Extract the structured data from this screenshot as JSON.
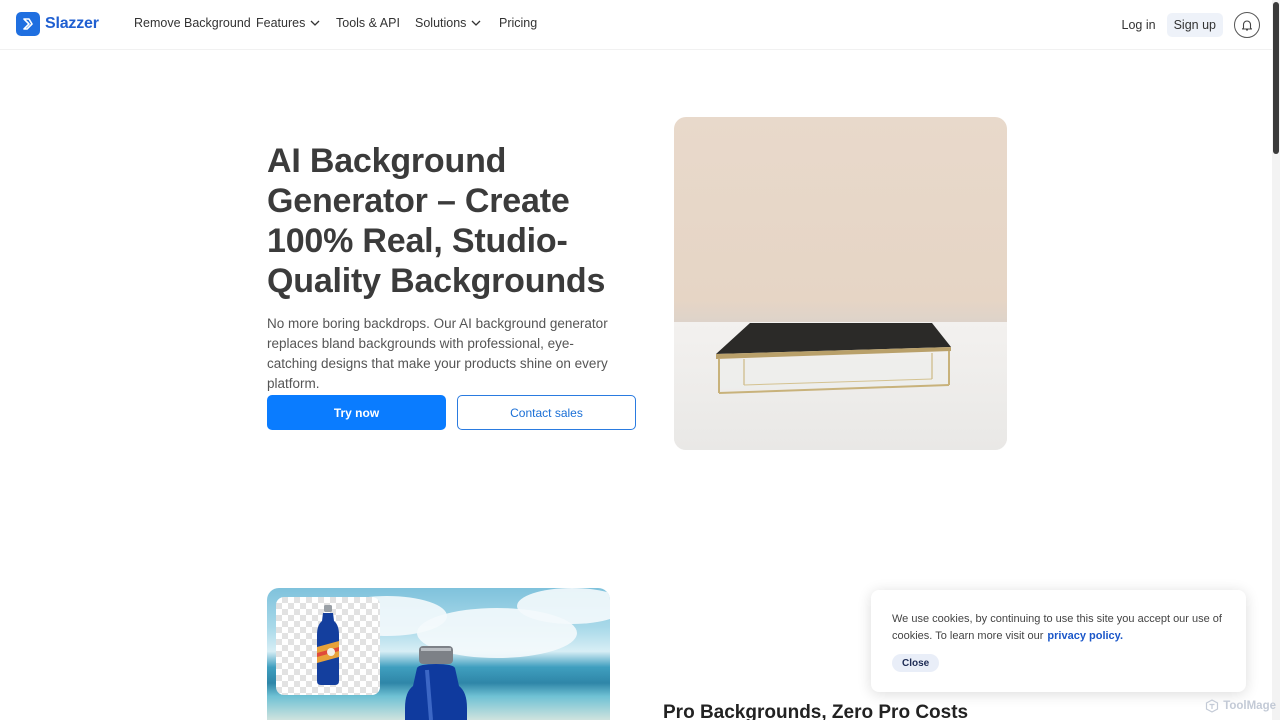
{
  "nav": {
    "logo_text": "Slazzer",
    "links": [
      {
        "label": "Remove Background"
      },
      {
        "label": "Features"
      },
      {
        "label": "Tools & API"
      },
      {
        "label": "Solutions"
      },
      {
        "label": "Pricing"
      }
    ],
    "login": "Log in",
    "signup": "Sign up"
  },
  "hero": {
    "title": "AI Background Generator – Create 100% Real, Studio-Quality Backgrounds",
    "description": "No more boring backdrops. Our AI background generator replaces bland backgrounds with professional, eye-catching designs that make your products shine on every platform.",
    "primary_button": "Try now",
    "secondary_button": "Contact sales"
  },
  "section2": {
    "title": "Pro Backgrounds, Zero Pro Costs"
  },
  "cookie": {
    "text": "We use cookies, by continuing to use this site you accept our use of cookies.  To learn more visit our",
    "link": "privacy policy.",
    "close": "Close"
  },
  "watermark": "ToolMage",
  "colors": {
    "brand": "#1f5fd1",
    "primary_button": "#0a7cff"
  }
}
